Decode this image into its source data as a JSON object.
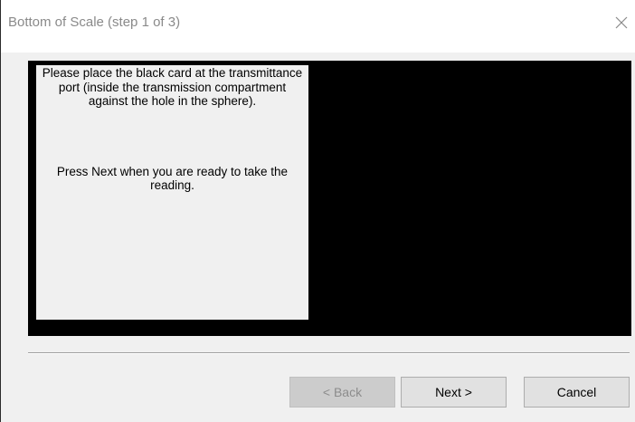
{
  "window": {
    "title": "Bottom of Scale (step 1 of 3)",
    "close_icon": "close-icon"
  },
  "instructions": {
    "paragraph1": "Please place the black card at the transmittance port (inside the transmission compartment against the hole in the sphere).",
    "paragraph2": "Press Next when you are ready to take the reading."
  },
  "buttons": {
    "back": {
      "label": "< Back",
      "enabled": false
    },
    "next": {
      "label": "Next >",
      "enabled": true
    },
    "cancel": {
      "label": "Cancel",
      "enabled": true
    }
  },
  "colors": {
    "panel_background": "#000000",
    "dialog_background": "#f0f0f0",
    "titlebar_background": "#ffffff"
  }
}
